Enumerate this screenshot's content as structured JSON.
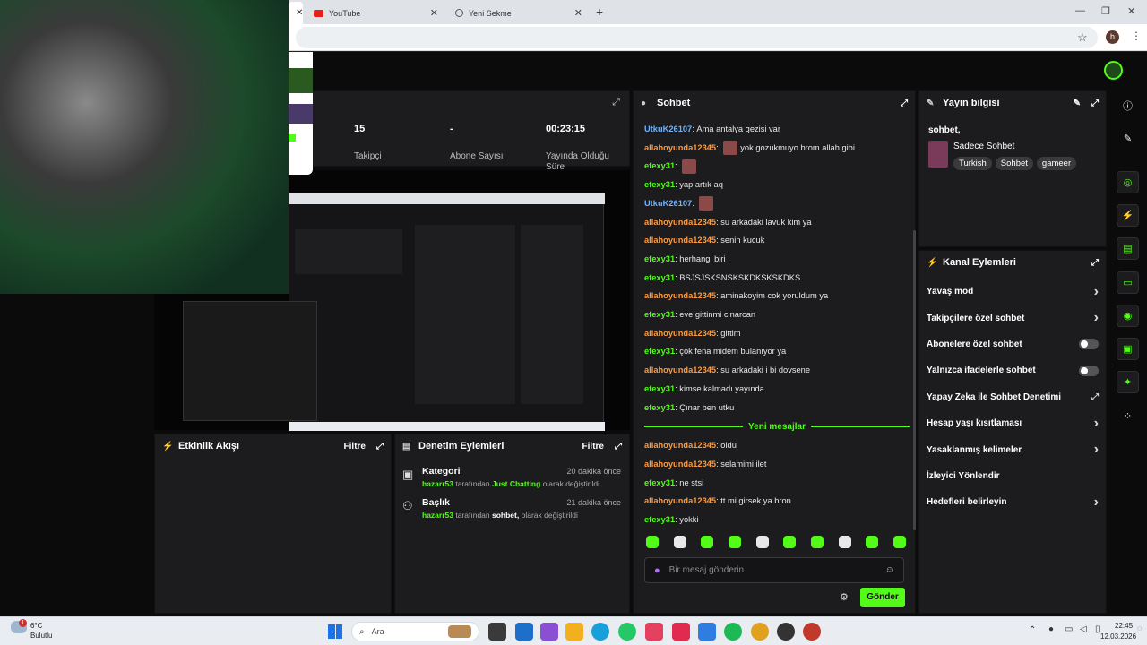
{
  "browser": {
    "tabs": [
      {
        "label": "YouTube",
        "icon": "youtube-icon"
      },
      {
        "label": "Yeni Sekme",
        "icon": "globe-icon"
      }
    ],
    "profile_initial": "h"
  },
  "stats": {
    "header_icon": "expand-icon",
    "items": [
      {
        "value": "15",
        "label": "Takipçi"
      },
      {
        "value": "-",
        "label": "Abone Sayısı"
      },
      {
        "value": "00:23:15",
        "label": "Yayında Olduğu Süre"
      }
    ]
  },
  "chat": {
    "title": "Sohbet",
    "messages": [
      {
        "user": "UtkuK26107",
        "cls": "u1",
        "text": "Ama antalya gezisi var"
      },
      {
        "user": "allahoyunda12345",
        "cls": "u2",
        "text": "yok gozukmuyo brom allah gibi",
        "emote": true
      },
      {
        "user": "efexy31",
        "cls": "u3",
        "text": "",
        "emote": true
      },
      {
        "user": "efexy31",
        "cls": "u3",
        "text": "yap artık aq"
      },
      {
        "user": "UtkuK26107",
        "cls": "u1",
        "text": "",
        "emote": true
      },
      {
        "user": "allahoyunda12345",
        "cls": "u2",
        "text": "su arkadaki lavuk kim ya"
      },
      {
        "user": "allahoyunda12345",
        "cls": "u2",
        "text": "senin kucuk"
      },
      {
        "user": "efexy31",
        "cls": "u3",
        "text": "herhangi biri"
      },
      {
        "user": "efexy31",
        "cls": "u3",
        "text": "BSJSJSKSNSKSKDKSKSKDKS"
      },
      {
        "user": "allahoyunda12345",
        "cls": "u2",
        "text": "aminakoyim cok yoruldum ya"
      },
      {
        "user": "efexy31",
        "cls": "u3",
        "text": "eve gittinmi cinarcan"
      },
      {
        "user": "allahoyunda12345",
        "cls": "u2",
        "text": "gittim"
      },
      {
        "user": "efexy31",
        "cls": "u3",
        "text": "çok fena midem bulanıyor ya"
      },
      {
        "user": "allahoyunda12345",
        "cls": "u2",
        "text": "su arkadaki i bi dovsene"
      },
      {
        "user": "efexy31",
        "cls": "u3",
        "text": "kimse kalmadı yayında"
      },
      {
        "user": "efexy31",
        "cls": "u3",
        "text": "Çınar ben utku"
      }
    ],
    "new_label": "Yeni mesajlar",
    "new_messages": [
      {
        "user": "allahoyunda12345",
        "cls": "u2",
        "text": "oldu"
      },
      {
        "user": "allahoyunda12345",
        "cls": "u2",
        "text": "selamimi ilet"
      },
      {
        "user": "efexy31",
        "cls": "u3",
        "text": "ne stsi"
      },
      {
        "user": "allahoyunda12345",
        "cls": "u2",
        "text": "tt mi girsek ya bron"
      },
      {
        "user": "efexy31",
        "cls": "u3",
        "text": "yokki"
      }
    ],
    "placeholder": "Bir mesaj gönderin",
    "send_label": "Gönder",
    "accent": "#53fc18"
  },
  "info": {
    "title": "Yayın bilgisi",
    "stream_title": "sohbet,",
    "category": "Sadece Sohbet",
    "tags": [
      "Turkish",
      "Sohbet",
      "gameer"
    ]
  },
  "channel": {
    "title": "Kanal Eylemleri",
    "items": [
      {
        "label": "Yavaş mod",
        "type": "chevron"
      },
      {
        "label": "Takipçilere özel sohbet",
        "type": "chevron"
      },
      {
        "label": "Abonelere özel sohbet",
        "type": "toggle"
      },
      {
        "label": "Yalnızca ifadelerle sohbet",
        "type": "toggle"
      },
      {
        "label": "Yapay Zeka ile Sohbet Denetimi",
        "type": "external"
      },
      {
        "label": "Hesap yaşı kısıtlaması",
        "type": "chevron"
      },
      {
        "label": "Yasaklanmış kelimeler",
        "type": "chevron"
      },
      {
        "label": "İzleyici Yönlendir",
        "type": "none"
      },
      {
        "label": "Hedefleri belirleyin",
        "type": "chevron"
      }
    ]
  },
  "activity": {
    "title": "Etkinlik Akışı",
    "filter": "Filtre"
  },
  "moderation": {
    "title": "Denetim Eylemleri",
    "filter": "Filtre",
    "items": [
      {
        "title": "Kategori",
        "time": "20 dakika önce",
        "actor": "hazarr53",
        "mid": "tarafından",
        "value": "Just Chatting",
        "tail": "olarak değiştirildi"
      },
      {
        "title": "Başlık",
        "time": "21 dakika önce",
        "actor": "hazarr53",
        "mid": "tarafından",
        "value": "sohbet,",
        "tail": "olarak değiştirildi"
      }
    ]
  },
  "taskbar": {
    "weather_temp": "6°C",
    "weather_desc": "Bulutlu",
    "weather_badge": "1",
    "search": "Ara",
    "time": "22:45",
    "date": "12.03.2026"
  }
}
